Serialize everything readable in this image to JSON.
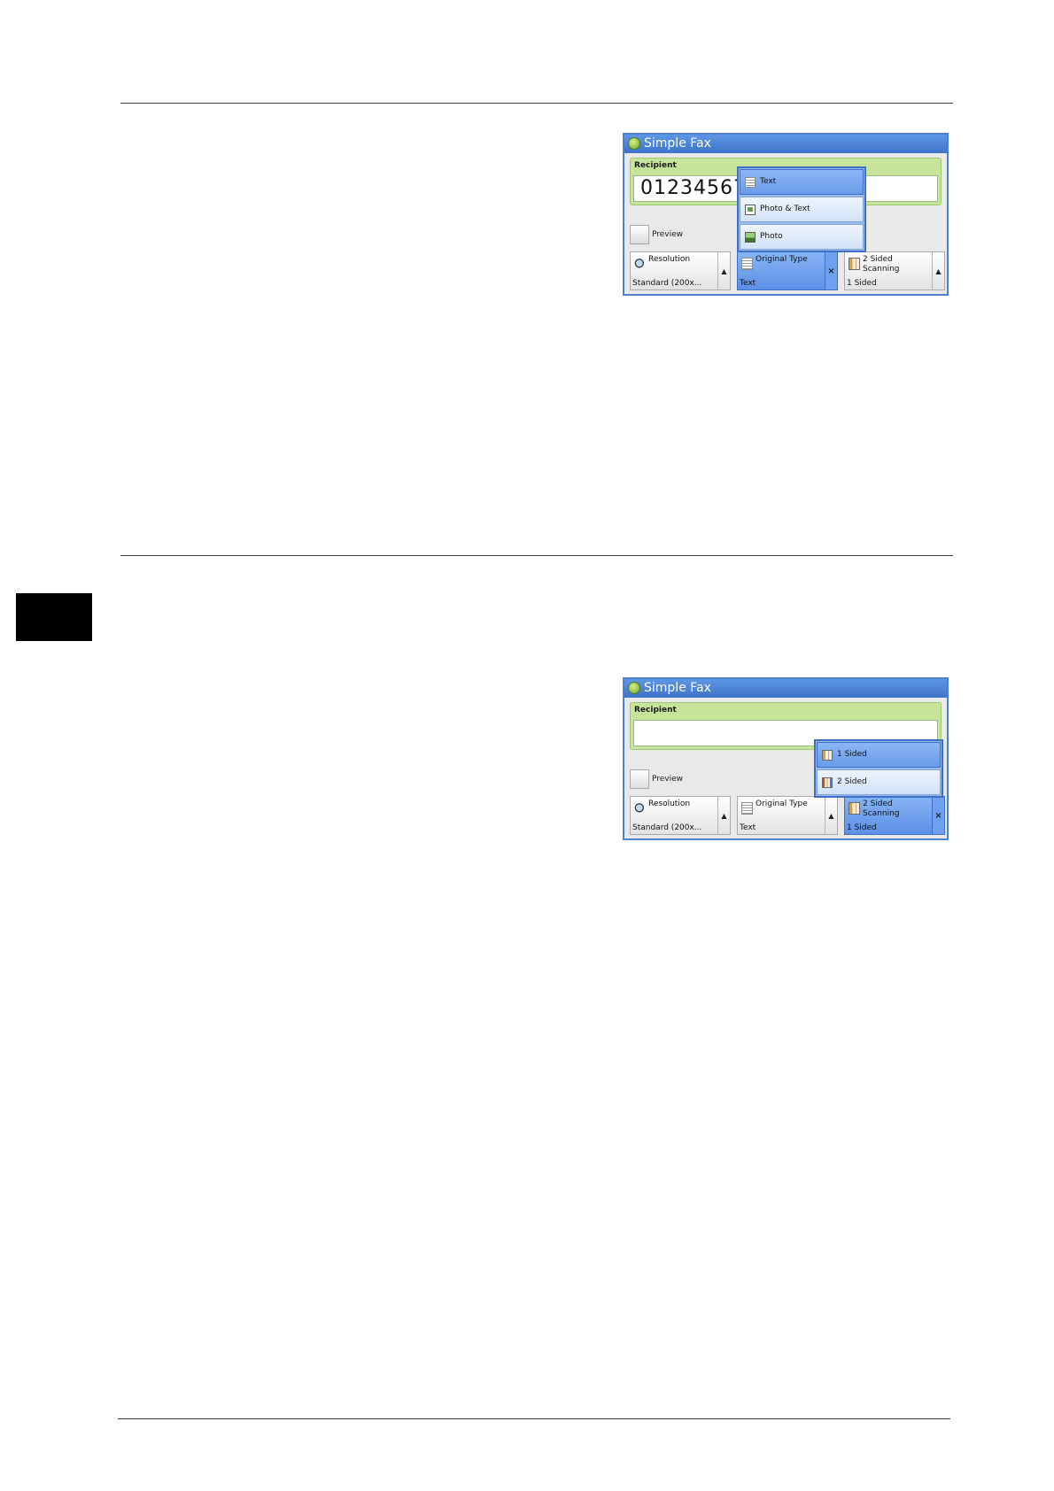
{
  "panels": [
    {
      "title": "Simple Fax",
      "recipient_label": "Recipient",
      "recipient_value": "0123456789",
      "preview_label": "Preview",
      "features": [
        {
          "name": "Resolution",
          "value": "Standard (200x...",
          "control": "▲",
          "active": false
        },
        {
          "name": "Original Type",
          "value": "Text",
          "control": "×",
          "active": true
        },
        {
          "name": "2 Sided Scanning",
          "value": "1 Sided",
          "control": "▲",
          "active": false
        }
      ],
      "popup_options": [
        {
          "label": "Text",
          "icon": "text-page-icon",
          "selected": true
        },
        {
          "label": "Photo & Text",
          "icon": "photo-text-icon",
          "selected": false
        },
        {
          "label": "Photo",
          "icon": "photo-icon",
          "selected": false
        }
      ]
    },
    {
      "title": "Simple Fax",
      "recipient_label": "Recipient",
      "recipient_value": "",
      "preview_label": "Preview",
      "features": [
        {
          "name": "Resolution",
          "value": "Standard (200x...",
          "control": "▲",
          "active": false
        },
        {
          "name": "Original Type",
          "value": "Text",
          "control": "▲",
          "active": false
        },
        {
          "name": "2 Sided Scanning",
          "value": "1 Sided",
          "control": "×",
          "active": true
        }
      ],
      "popup_options": [
        {
          "label": "1 Sided",
          "icon": "one-sided-icon",
          "selected": true
        },
        {
          "label": "2 Sided",
          "icon": "two-sided-icon",
          "selected": false
        }
      ]
    }
  ]
}
